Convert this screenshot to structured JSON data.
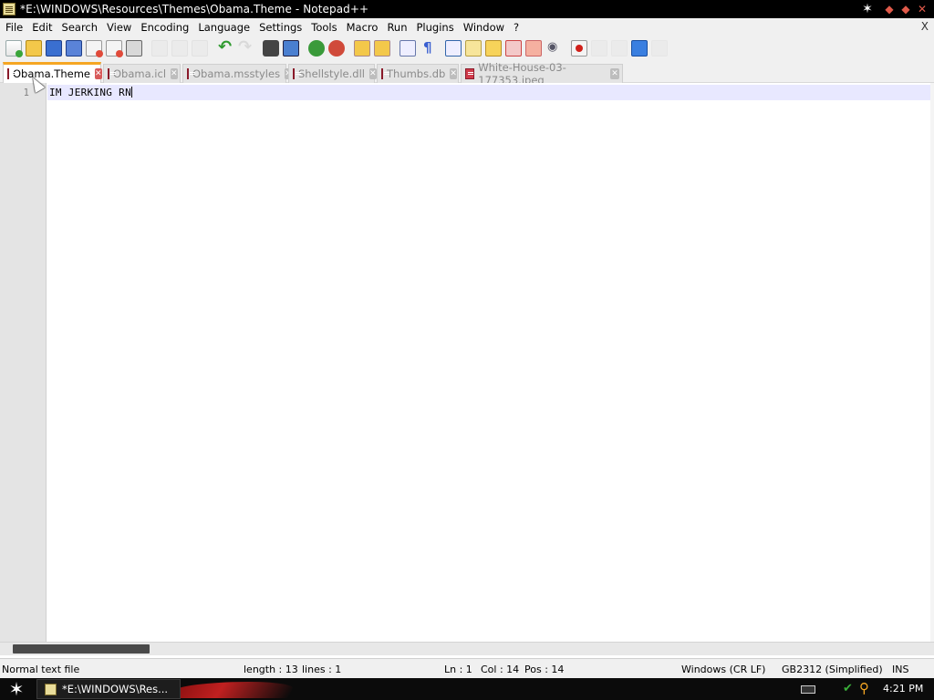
{
  "window": {
    "title": "*E:\\WINDOWS\\Resources\\Themes\\Obama.Theme - Notepad++",
    "icons": {
      "app": "notepad-icon",
      "pin": "star-icon",
      "minimize": "minimize-icon",
      "restore": "restore-icon",
      "close": "close-icon"
    }
  },
  "menu": {
    "items": [
      "File",
      "Edit",
      "Search",
      "View",
      "Encoding",
      "Language",
      "Settings",
      "Tools",
      "Macro",
      "Run",
      "Plugins",
      "Window",
      "?"
    ],
    "close_doc": "X"
  },
  "tabs": [
    {
      "label": "Obama.Theme",
      "active": true
    },
    {
      "label": "Obama.icl",
      "active": false
    },
    {
      "label": "Obama.msstyles",
      "active": false
    },
    {
      "label": "Shellstyle.dll",
      "active": false
    },
    {
      "label": "Thumbs.db",
      "active": false
    },
    {
      "label": "White-House-03-177353.jpeg",
      "active": false
    }
  ],
  "editor": {
    "line_numbers": [
      "1"
    ],
    "lines": [
      "IM JERKING RN"
    ]
  },
  "statusbar": {
    "language": "Normal text file",
    "length": "length : 13",
    "lines": "lines : 1",
    "ln": "Ln : 1",
    "col": "Col : 14",
    "pos": "Pos : 14",
    "eol": "Windows (CR LF)",
    "encoding": "GB2312 (Simplified)",
    "mode": "INS"
  },
  "taskbar": {
    "task_label": "*E:\\WINDOWS\\Res...",
    "clock": "4:21 PM"
  },
  "colors": {
    "titlebar_bg": "#000000",
    "active_tab_accent": "#f5a623",
    "current_line": "#e8e8ff"
  }
}
